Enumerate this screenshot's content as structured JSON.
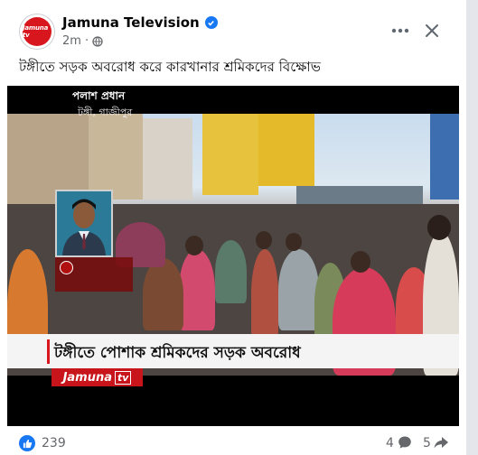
{
  "post": {
    "page_name": "Jamuna Television",
    "time": "2m",
    "privacy_icon": "globe-icon",
    "caption": "টঙ্গীতে সড়ক অবরোধ করে কারখানার শ্রমিকদের বিক্ষোভ",
    "avatar_text": "Jamuna tv"
  },
  "video": {
    "reporter_name": "পলাশ প্রধান",
    "reporter_location": "টঙ্গী, গাজীপুর",
    "headline": "টঙ্গীতে পোশাক শ্রমিকদের সড়ক অবরোধ",
    "channel_logo": "Jamuna",
    "channel_logo_suffix": "tv"
  },
  "footer": {
    "likes": "239",
    "comments": "4",
    "shares": "5"
  },
  "colors": {
    "brand_red": "#d7161e",
    "facebook_blue": "#1877f2"
  }
}
